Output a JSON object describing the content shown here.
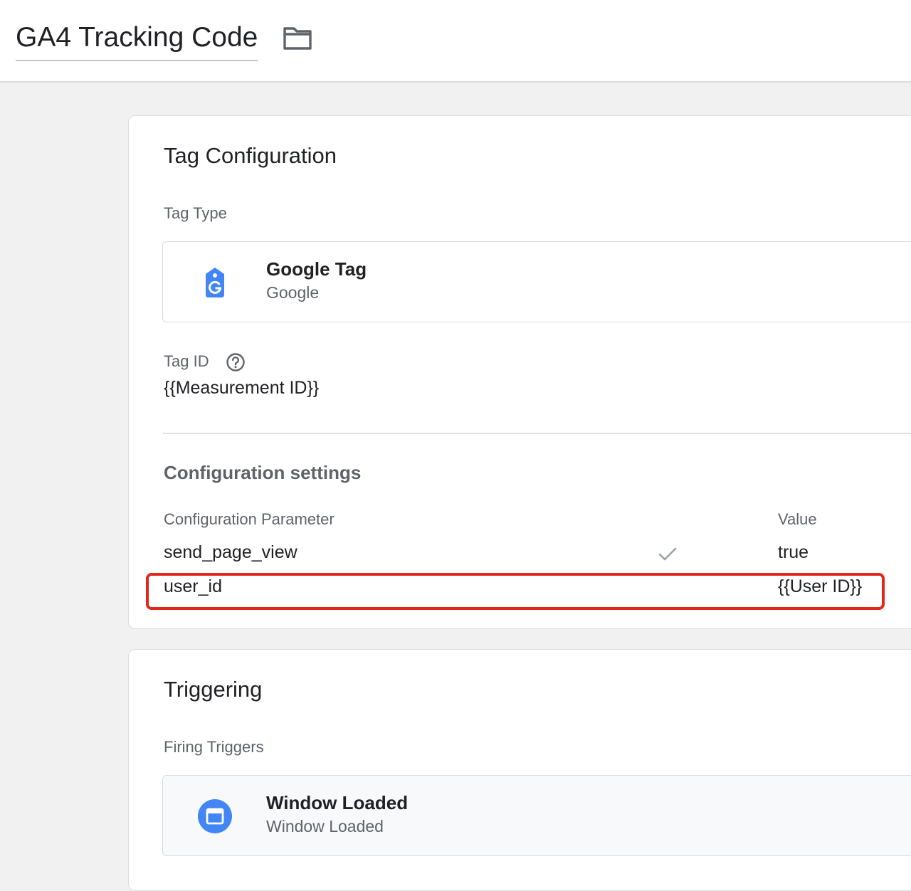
{
  "header": {
    "title": "GA4 Tracking Code",
    "folder_icon": "folder-icon"
  },
  "tag_configuration": {
    "title": "Tag Configuration",
    "tag_type_label": "Tag Type",
    "tag_type": {
      "name": "Google Tag",
      "vendor": "Google",
      "icon": "google-tag-icon"
    },
    "tag_id_label": "Tag ID",
    "tag_id_help_icon": "help-icon",
    "tag_id_value": "{{Measurement ID}}",
    "settings_title": "Configuration settings",
    "columns": {
      "parameter": "Configuration Parameter",
      "value": "Value"
    },
    "rows": [
      {
        "parameter": "send_page_view",
        "value": "true",
        "check_icon": "checkmark-icon"
      },
      {
        "parameter": "user_id",
        "value": "{{User ID}}",
        "highlighted": true
      }
    ],
    "highlight_color": "#e0271a"
  },
  "triggering": {
    "title": "Triggering",
    "firing_triggers_label": "Firing Triggers",
    "trigger": {
      "name": "Window Loaded",
      "type": "Window Loaded",
      "icon": "window-icon"
    }
  },
  "colors": {
    "google_blue": "#4285f4",
    "trigger_blue": "#4285f4",
    "page_background": "#f1f1f1"
  }
}
